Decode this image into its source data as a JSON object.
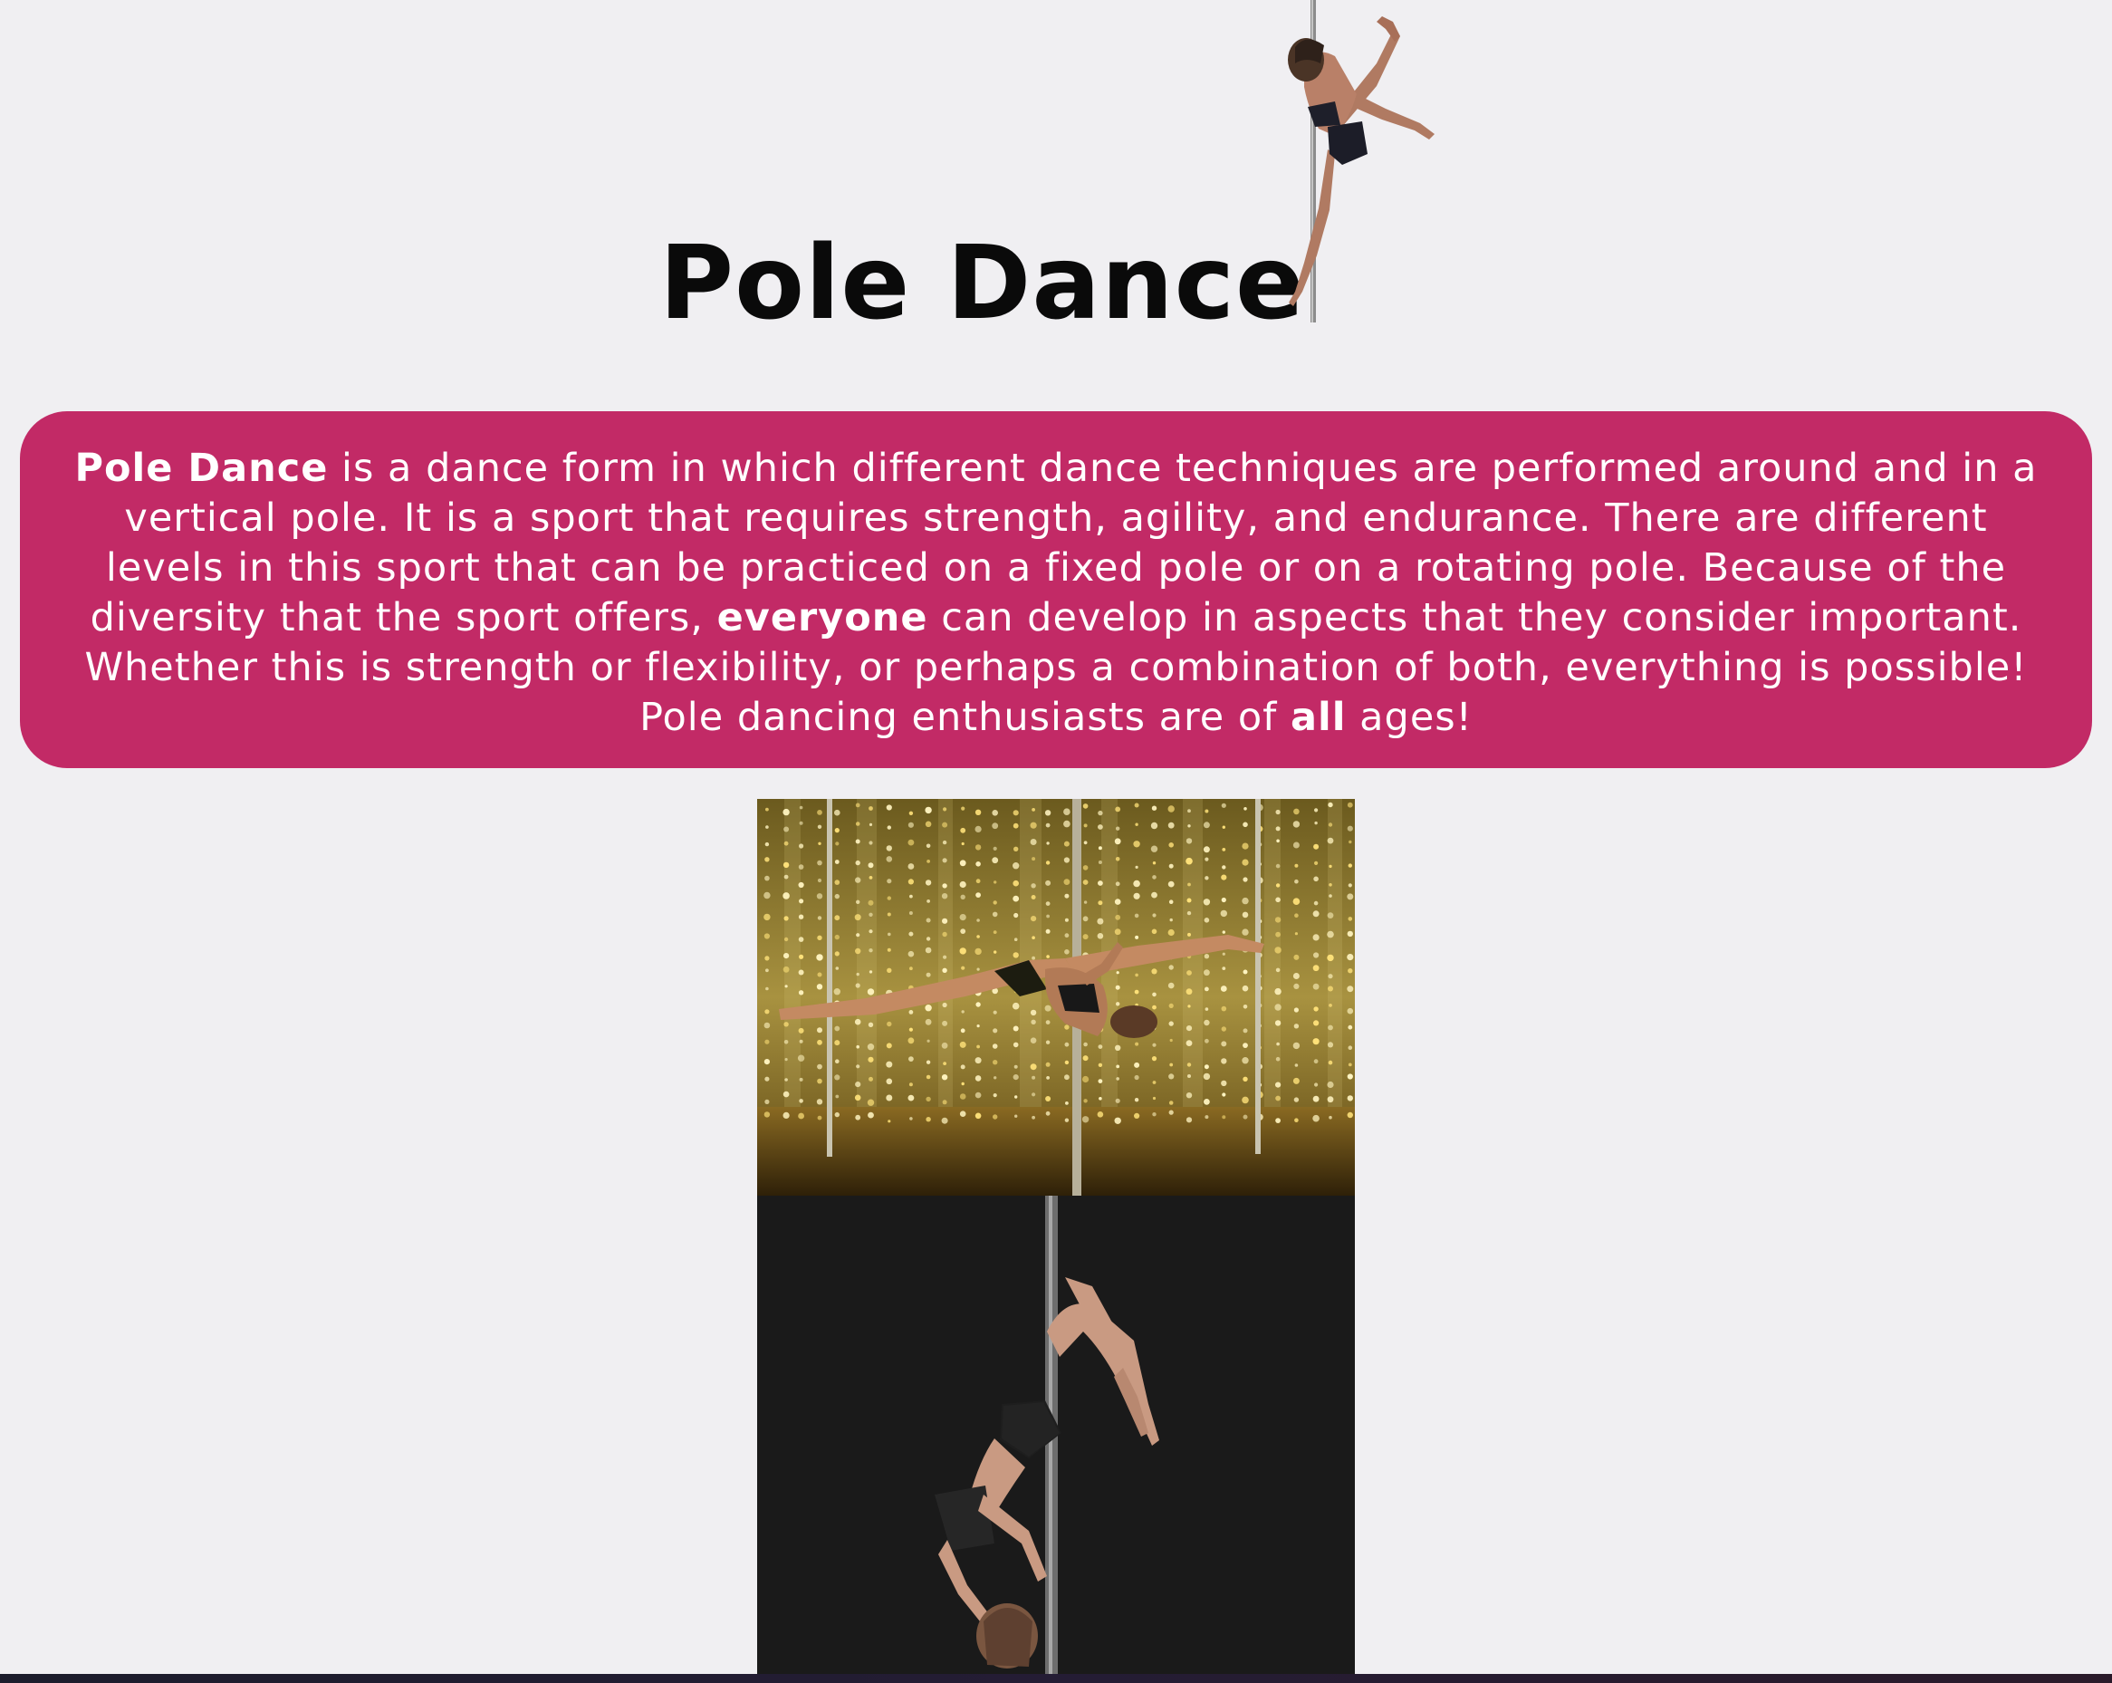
{
  "header": {
    "title": "Pole Dance"
  },
  "intro": {
    "seg1_bold": "Pole Dance",
    "seg2": " is a dance form in which different dance techniques are performed around and in a vertical pole. It is a sport that requires strength, agility, and endurance. There are different levels in this sport that can be practiced on a fixed pole or on a rotating pole. Because of the diversity that the sport offers, ",
    "seg3_bold": "everyone",
    "seg4": " can develop in aspects that they consider important. Whether this is strength or flexibility, or perhaps a combination of both, everything is possible! Pole dancing enthusiasts are of ",
    "seg5_bold": "all",
    "seg6": " ages!"
  },
  "images": {
    "hero": "pole-dancer-figure",
    "photo1": "pole-split-fairy-lights-photo",
    "photo2": "pole-inverted-dark-photo"
  },
  "colors": {
    "background": "#f0eff2",
    "intro_box": "#c22a66",
    "title": "#0a0a0a"
  }
}
